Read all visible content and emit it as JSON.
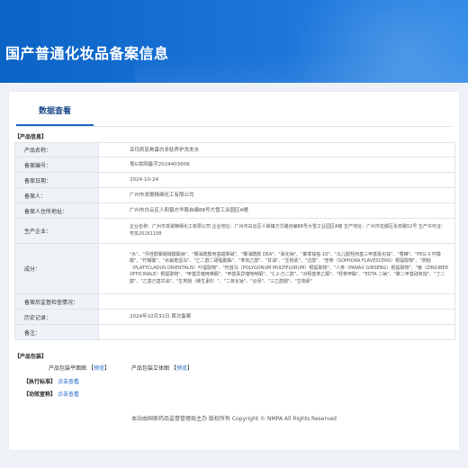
{
  "header": {
    "title": "国产普通化妆品备案信息"
  },
  "tabs": [
    {
      "label": "数据查看"
    }
  ],
  "product_info": {
    "section_title": "【产品信息】",
    "rows": [
      {
        "label": "产品名称：",
        "value": "亚玛莉茄角蛋白多肽养护洗发水"
      },
      {
        "label": "备案编号：",
        "value": "粤G妆网备字2024403606"
      },
      {
        "label": "备案日期：",
        "value": "2024-10-24"
      },
      {
        "label": "备案人：",
        "value": "广州市发歌精细化工有限公司"
      },
      {
        "label": "备案人住所地址：",
        "value": "广州市白云区人和镇方华路自编88号大雪工业园区A幢"
      },
      {
        "label": "生产企业：",
        "value": "企业名称：广州市发歌精细化工有限公司 企业地址：广州市白云区人和镇方华路自编88号大雪工业园区A幢 生产地址：广州市花都区永安路52号 生产许可证：粤妆20161108"
      },
      {
        "label": "成分：",
        "value": "\"水\"、\"月桂醇聚醚硫酸酯钠\"、\"椰油酰胺丙基甜菜碱\"、\"椰油酰胺 DEA\"、\"氯化钠\"、\"聚季铵盐-10\"、\"瓜儿胶羟丙基三甲基氯化铵\"、\"香精\"、\"PEG-3 柠檬酸\"、\"柠檬酸\"、\"水解角蛋白\"、\"乙二醇二硬脂酸酯\"、\"苯氧乙醇\"、\"甘油\"、\"生物素\"、\"泛醇\"、\"苦参（SOPHORA FLAVESCENS）根提取物\"、\"侧柏（PLATYCLADUS ORIENTALIS）叶提取物\"、\"何首乌（POLYGONUM MULTIFLORUM）根提取物\"、\"人参（PANAX GINSENG）根提取物\"、\"姜（ZINGIBER OFFICINALE）根提取物\"、\"甲基异噻唑啉酮\"、\"甲基氯异噻唑啉酮\"、\"1,2-己二醇\"、\"对羟基苯乙酮\"、\"羟苯甲酯\"、\"EDTA 二钠\"、\"聚二甲基硅氧烷\"、\"丁二醇\"、\"乙基己基甘油\"、\"生育酚（维生素E）\"、\"二氧化钛\"、\"云母\"、\"三乙醇胺\"、\"生物素\""
      },
      {
        "label": "备案后监督检查情况：",
        "value": ""
      },
      {
        "label": "历史记录：",
        "value": "2024年10月31日 首次备案"
      },
      {
        "label": "备注：",
        "value": ""
      }
    ]
  },
  "packaging": {
    "section_title": "【产品包装】",
    "flat_label": "产品包装平面图",
    "flat_link": "预览",
    "solid_label": "产品包装立体图",
    "solid_link": "预览"
  },
  "standard": {
    "section_title": "【执行标准】",
    "link": "点击查看"
  },
  "claims": {
    "section_title": "【功效宣称】",
    "link": "点击查看"
  },
  "footer": {
    "text": "本站由国家药品监督管理局主办 版权所有 Copyright © NMPA All Rights Reserved"
  }
}
